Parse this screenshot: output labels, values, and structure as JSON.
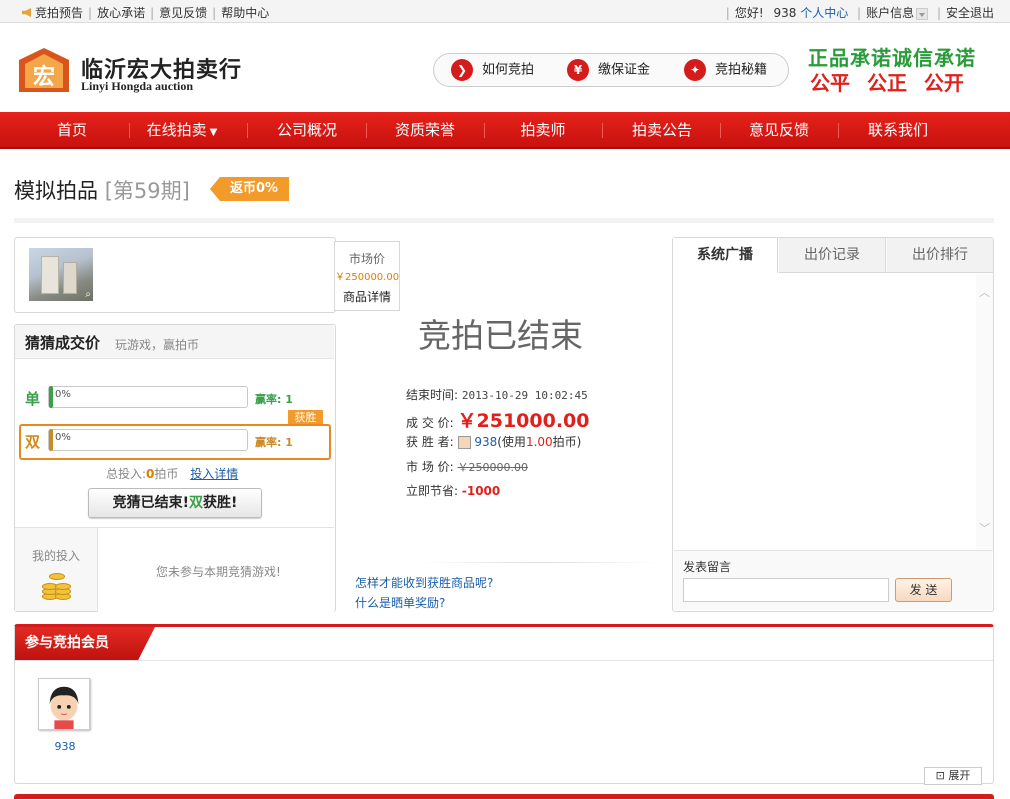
{
  "topbar": {
    "preview": "竞拍预告",
    "links": [
      "放心承诺",
      "意见反馈",
      "帮助中心"
    ],
    "greeting": "您好!",
    "username": "938",
    "personal_center": "个人中心",
    "account_info": "账户信息",
    "logout": "安全退出"
  },
  "logo": {
    "cn": "临沂宏大拍卖行",
    "en": "Linyi Hongda auction",
    "mark": "宏"
  },
  "help": [
    {
      "label": "如何竞拍",
      "icon": "arrow-right-icon",
      "glyph": "❯"
    },
    {
      "label": "缴保证金",
      "icon": "yuan-icon",
      "glyph": "¥"
    },
    {
      "label": "竞拍秘籍",
      "icon": "key-icon",
      "glyph": "✦"
    }
  ],
  "slogan": {
    "line1": "正品承诺诚信承诺",
    "line2": "公平 公正 公开"
  },
  "nav": [
    "首页",
    "在线拍卖",
    "公司概况",
    "资质荣誉",
    "拍卖师",
    "拍卖公告",
    "意见反馈",
    "联系我们"
  ],
  "page": {
    "title": "模拟拍品",
    "period": "[第59期]",
    "rebate": "返币0%"
  },
  "product": {
    "market_label": "市场价",
    "market_price": "￥250000.00",
    "detail_button": "商品详情"
  },
  "guess": {
    "title": "猜猜成交价",
    "subtitle": "玩游戏，赢拍币",
    "single": {
      "label": "单",
      "percent": "0%",
      "rate": "赢率: 1"
    },
    "double": {
      "label": "双",
      "percent": "0%",
      "rate": "赢率: 1"
    },
    "win_badge": "获胜",
    "total_prefix": "总投入:",
    "total_value": "0",
    "total_unit": "拍币",
    "total_detail": "投入详情",
    "ended_prefix": "竞猜已结束!",
    "ended_result": "双",
    "ended_suffix": "获胜!",
    "my_invest": "我的投入",
    "not_joined": "您未参与本期竞猜游戏!"
  },
  "auction": {
    "status": "竞拍已结束",
    "end_time_label": "结束时间:",
    "end_time": "2013-10-29 10:02:45",
    "deal_label": "成 交 价:",
    "deal_price": "￥251000.00",
    "winner_label": "获 胜 者:",
    "winner_name": "938",
    "winner_note_prefix": "(使用",
    "winner_coins": "1.00",
    "winner_note_suffix": "拍币)",
    "market_label": "市 场 价:",
    "market_price": "￥250000.00",
    "saving_label": "立即节省:",
    "saving": "-1000",
    "faq": [
      "怎样才能收到获胜商品呢?",
      "什么是晒单奖励?"
    ]
  },
  "tabs": [
    "系统广播",
    "出价记录",
    "出价排行"
  ],
  "comment": {
    "label": "发表留言",
    "send": "发 送"
  },
  "members": {
    "title": "参与竞拍会员",
    "list": [
      {
        "name": "938"
      }
    ],
    "expand": "展开"
  }
}
